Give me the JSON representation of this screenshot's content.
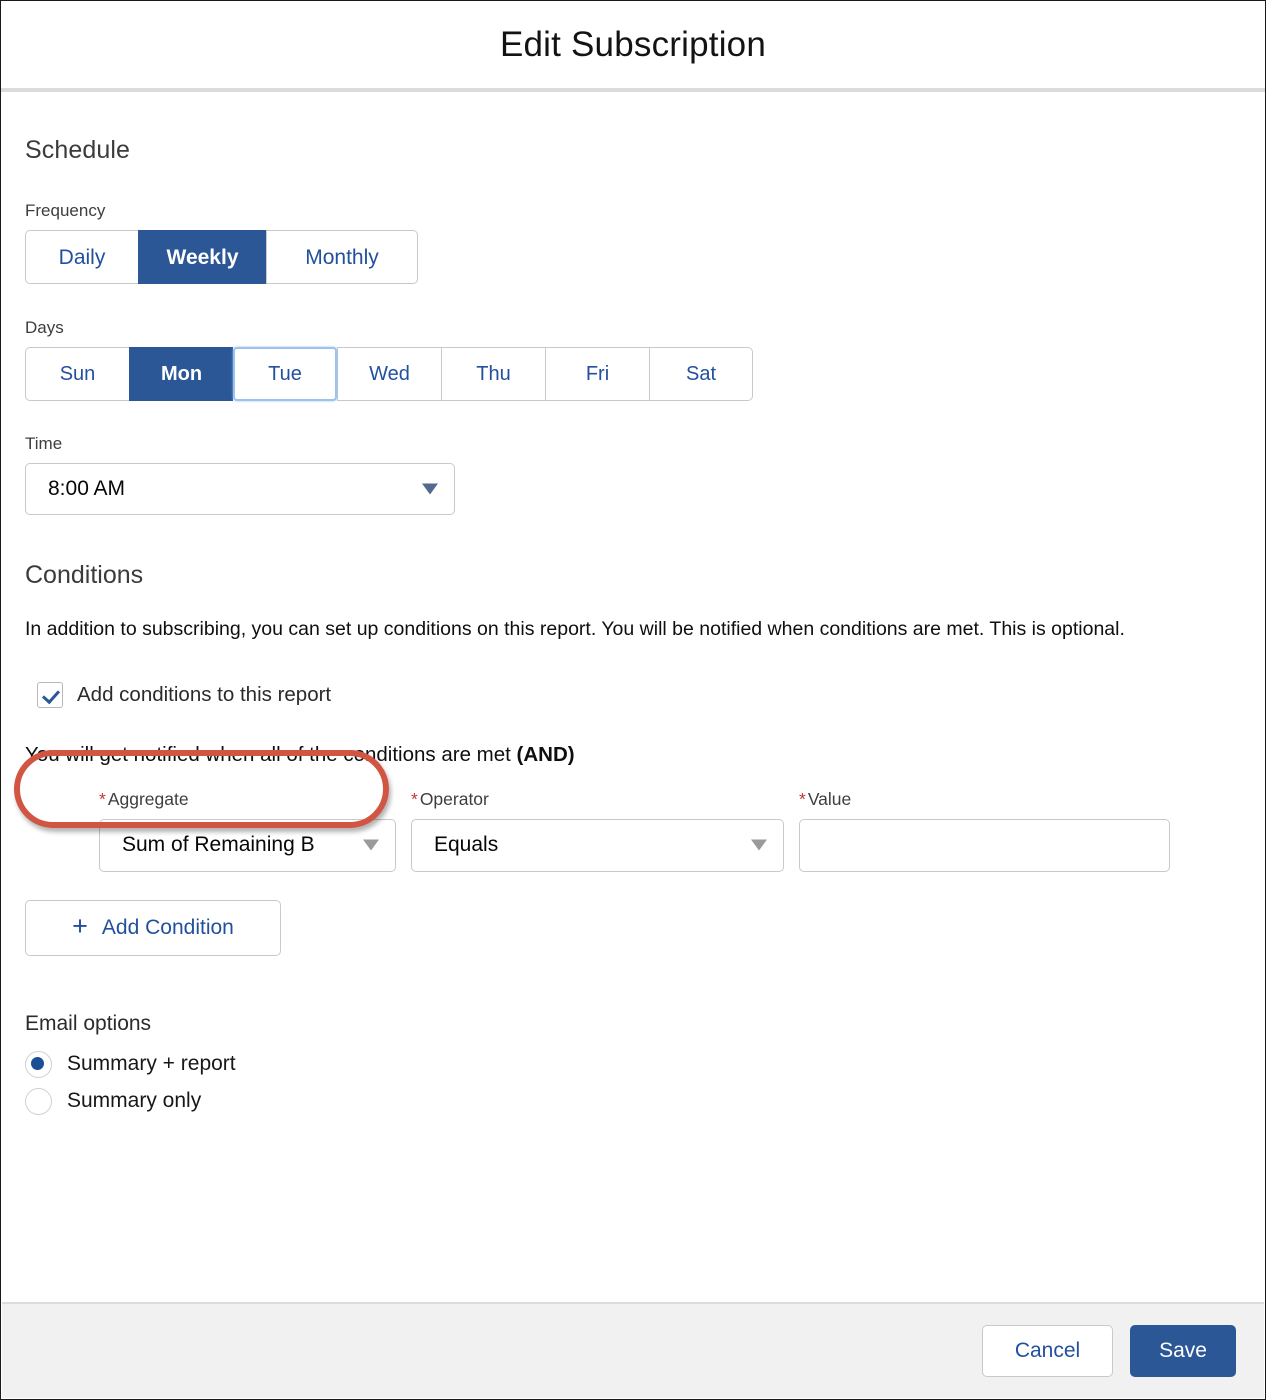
{
  "header": {
    "title": "Edit Subscription"
  },
  "schedule": {
    "section_title": "Schedule",
    "frequency_label": "Frequency",
    "frequency_options": [
      "Daily",
      "Weekly",
      "Monthly"
    ],
    "frequency_selected": "Weekly",
    "days_label": "Days",
    "days_options": [
      "Sun",
      "Mon",
      "Tue",
      "Wed",
      "Thu",
      "Fri",
      "Sat"
    ],
    "days_selected": "Mon",
    "days_focused": "Tue",
    "time_label": "Time",
    "time_value": "8:00 AM"
  },
  "conditions": {
    "section_title": "Conditions",
    "description": "In addition to subscribing, you can set up conditions on this report. You will be notified when conditions are met. This is optional.",
    "checkbox_label": "Add conditions to this report",
    "checkbox_checked": "true",
    "and_text_prefix": "You will get notified when all of the conditions are met ",
    "and_text_bold": "(AND)",
    "aggregate_label": "Aggregate",
    "aggregate_value": "Sum of Remaining B",
    "operator_label": "Operator",
    "operator_value": "Equals",
    "value_label": "Value",
    "value_value": "",
    "required_star": "*",
    "add_condition_label": "Add Condition",
    "add_condition_icon": "plus-icon"
  },
  "email_options": {
    "title": "Email options",
    "options": [
      {
        "label": "Summary + report",
        "selected": "true"
      },
      {
        "label": "Summary only",
        "selected": "false"
      }
    ]
  },
  "footer": {
    "cancel_label": "Cancel",
    "save_label": "Save"
  },
  "annotation": {
    "shape": "red-oval-highlight",
    "color": "#d05543",
    "target": "add-conditions-checkbox"
  },
  "colors": {
    "brand_blue": "#2b5797",
    "link_blue": "#23509e",
    "required_red": "#c23934",
    "annotation_red": "#d05543",
    "footer_bg": "#f1f1f2",
    "border_gray": "#c9c9c9"
  }
}
